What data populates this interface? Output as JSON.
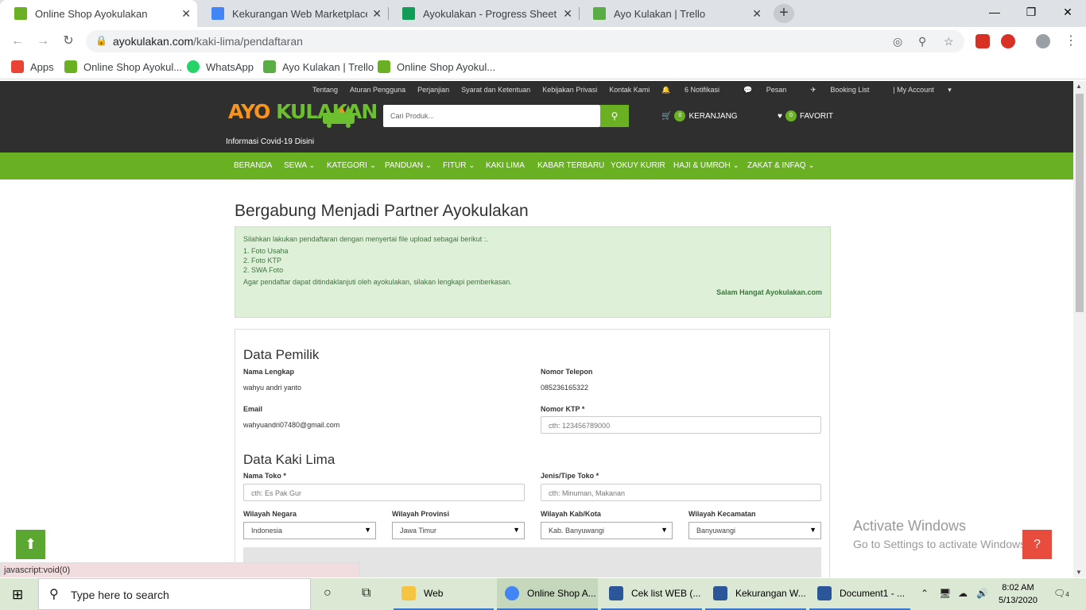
{
  "browser": {
    "tabs": [
      {
        "title": "Online Shop Ayokulakan",
        "active": true,
        "color": "#6ab023"
      },
      {
        "title": "Kekurangan Web Marketplace Ayoku",
        "active": false,
        "color": "#4285f4"
      },
      {
        "title": "Ayokulakan - Progress Sheet (Yudi)",
        "active": false,
        "color": "#0f9d58"
      },
      {
        "title": "Ayo Kulakan | Trello",
        "active": false,
        "color": "#5aac44"
      }
    ],
    "url_domain": "ayokulakan.com",
    "url_path": "/kaki-lima/pendaftaran",
    "bookmarks": [
      {
        "label": "Apps"
      },
      {
        "label": "Online Shop Ayokul..."
      },
      {
        "label": "WhatsApp"
      },
      {
        "label": "Ayo Kulakan | Trello"
      },
      {
        "label": "Online Shop Ayokul..."
      }
    ],
    "status_text": "javascript:void(0)"
  },
  "site": {
    "toplinks": [
      "Tentang",
      "Aturan Pengguna",
      "Perjanjian",
      "Syarat dan Ketentuan",
      "Kebijakan Privasi",
      "Kontak Kami",
      "6 Notifikasi",
      "Pesan",
      "Booking List",
      "| My Account"
    ],
    "logo_a": "AYO ",
    "logo_b": "KULAKAN",
    "covid": "Informasi Covid-19 Disini",
    "search_placeholder": "Cari Produk...",
    "cart_count": "0",
    "cart_label": "KERANJANG",
    "fav_count": "0",
    "fav_label": "FAVORIT",
    "nav": [
      "BERANDA",
      "SEWA",
      "KATEGORI",
      "PANDUAN",
      "FITUR",
      "KAKI LIMA",
      "KABAR TERBARU",
      "YOKUY KURIR",
      "HAJI & UMROH",
      "ZAKAT & INFAQ"
    ]
  },
  "main": {
    "title": "Bergabung Menjadi Partner Ayokulakan",
    "notice": {
      "lines": [
        "Silahkan lakukan pendaftaran dengan menyertai file upload sebagai berikut :.",
        "1. Foto Usaha",
        "2. Foto KTP",
        "2. SWA Foto",
        "Agar pendaftar dapat ditindaklanjuti oleh ayokulakan, silakan lengkapi pemberkasan."
      ],
      "signature": "Salam Hangat Ayokulakan.com"
    },
    "owner": {
      "heading": "Data Pemilik",
      "name_label": "Nama Lengkap",
      "name_value": "wahyu andri yanto",
      "phone_label": "Nomor Telepon",
      "phone_value": "085236165322",
      "email_label": "Email",
      "email_value": "wahyuandri07480@gmail.com",
      "ktp_label": "Nomor KTP *",
      "ktp_placeholder": "cth: 123456789000"
    },
    "shop": {
      "heading": "Data Kaki Lima",
      "store_label": "Nama Toko *",
      "store_placeholder": "cth: Es Pak Gur",
      "type_label": "Jenis/Tipe Toko *",
      "type_placeholder": "cth: Minuman, Makanan",
      "country_label": "Wilayah Negara",
      "country_value": "Indonesia",
      "province_label": "Wilayah Provinsi",
      "province_value": "Jawa Timur",
      "city_label": "Wilayah Kab/Kota",
      "city_value": "Kab. Banyuwangi",
      "district_label": "Wilayah Kecamatan",
      "district_value": "Banyuwangi"
    }
  },
  "watermark": {
    "line1": "Activate Windows",
    "line2": "Go to Settings to activate Windows."
  },
  "taskbar": {
    "search_text": "Type here to search",
    "apps": [
      {
        "label": "Web",
        "active": false
      },
      {
        "label": "Online Shop A...",
        "active": true
      },
      {
        "label": "Cek list WEB (...",
        "active": false
      },
      {
        "label": "Kekurangan W...",
        "active": false
      },
      {
        "label": "Document1 - ...",
        "active": false
      }
    ],
    "time": "8:02 AM",
    "date": "5/13/2020",
    "notif_count": "4"
  }
}
